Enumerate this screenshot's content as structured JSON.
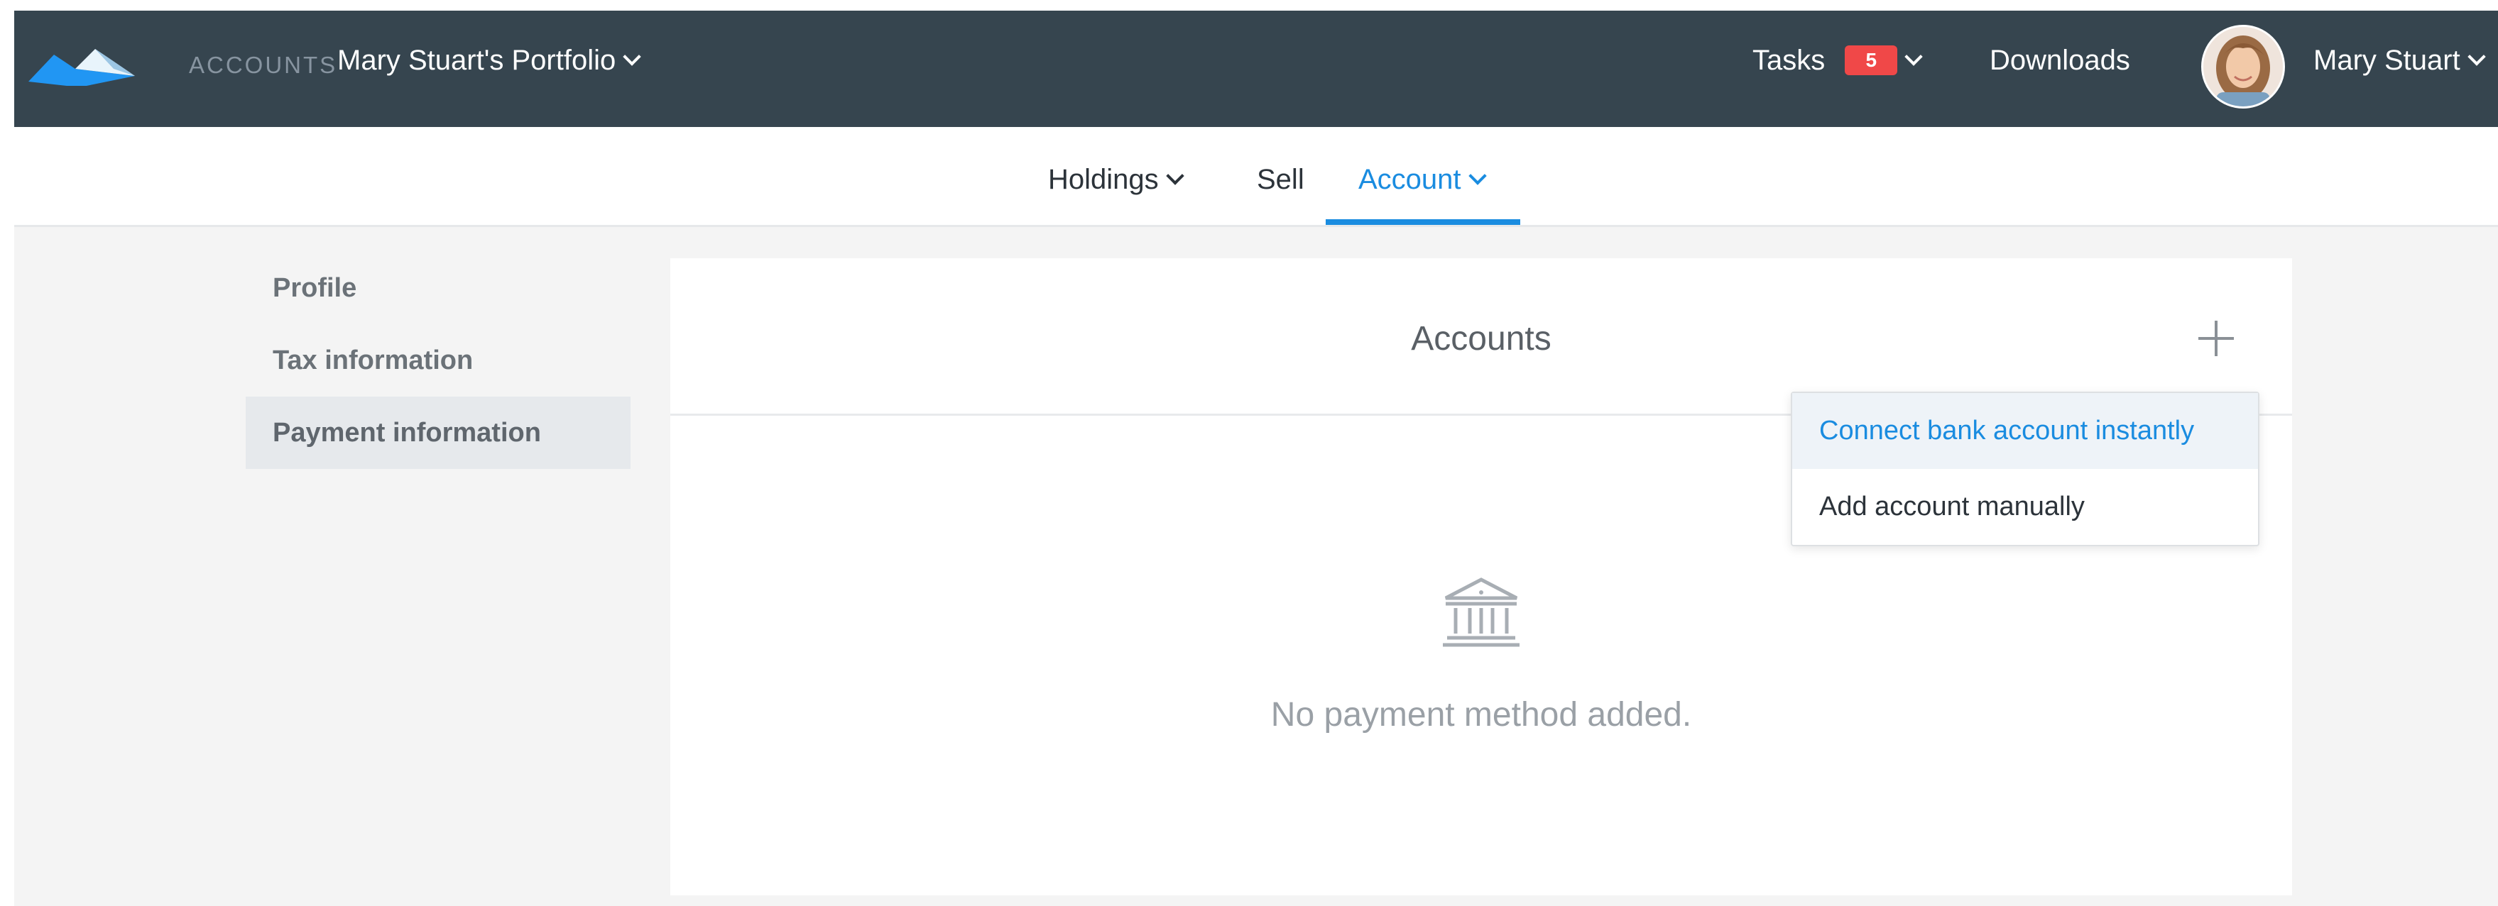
{
  "header": {
    "section_label": "ACCOUNTS",
    "portfolio_name": "Mary Stuart's Portfolio",
    "tasks_label": "Tasks",
    "tasks_count": "5",
    "downloads_label": "Downloads",
    "user_name": "Mary Stuart"
  },
  "subnav": {
    "tabs": [
      {
        "label": "Holdings"
      },
      {
        "label": "Sell"
      },
      {
        "label": "Account"
      }
    ],
    "active": "Account"
  },
  "sidebar": {
    "items": [
      {
        "label": "Profile"
      },
      {
        "label": "Tax information"
      },
      {
        "label": "Payment information"
      }
    ],
    "active": "Payment information"
  },
  "card": {
    "title": "Accounts",
    "empty_message": "No payment method added."
  },
  "dropdown": {
    "options": [
      {
        "label": "Connect bank account instantly"
      },
      {
        "label": "Add account manually"
      }
    ],
    "highlighted": "Connect bank account instantly"
  },
  "icons": {
    "logo": "mountain-logo-icon",
    "add": "plus-icon",
    "empty_state": "bank-icon",
    "chevron": "chevron-down-icon"
  },
  "colors": {
    "topbar": "#36454f",
    "accent": "#1a8ce0",
    "badge": "#f04848",
    "page_bg": "#f4f4f4"
  }
}
